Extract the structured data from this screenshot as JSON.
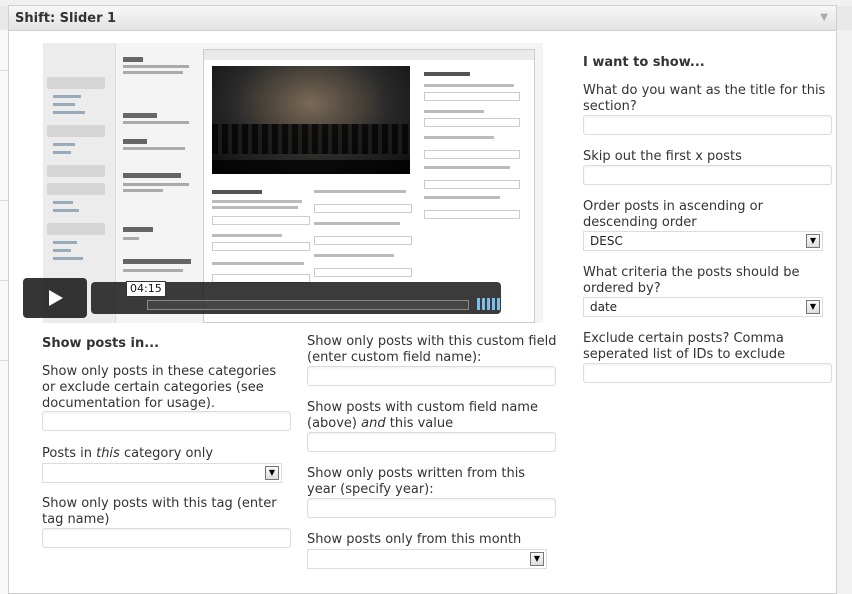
{
  "dialog": {
    "title": "Shift: Slider 1"
  },
  "video": {
    "time": "04:15"
  },
  "left": {
    "heading": "Show posts in...",
    "categories_label": "Show only posts in these categories or exclude certain categories (see documentation for usage).",
    "category_only_label": {
      "before": "Posts in ",
      "emph": "this",
      "after": " category only"
    },
    "tag_label": "Show only posts with this tag (enter tag name)"
  },
  "middle": {
    "custom_field_label": "Show only posts with this custom field (enter custom field name):",
    "custom_value_label": {
      "before": "Show posts with custom field name (above) ",
      "emph": "and",
      "after": " this value"
    },
    "year_label": "Show only posts written from this year (specify year):",
    "month_label": "Show posts only from this month"
  },
  "right": {
    "heading": "I want to show...",
    "title_label": "What do you want as the title for this section?",
    "skip_label": "Skip out the first x posts",
    "order_label": "Order posts in ascending or descending order",
    "order_value": "DESC",
    "criteria_label": "What criteria the posts should be ordered by?",
    "criteria_value": "date",
    "exclude_label": "Exclude certain posts? Comma seperated list of IDs to exclude"
  },
  "icons": {
    "collapse": "▼",
    "dropdown": "▼",
    "play": "play-icon",
    "fullscreen": "⤢"
  }
}
